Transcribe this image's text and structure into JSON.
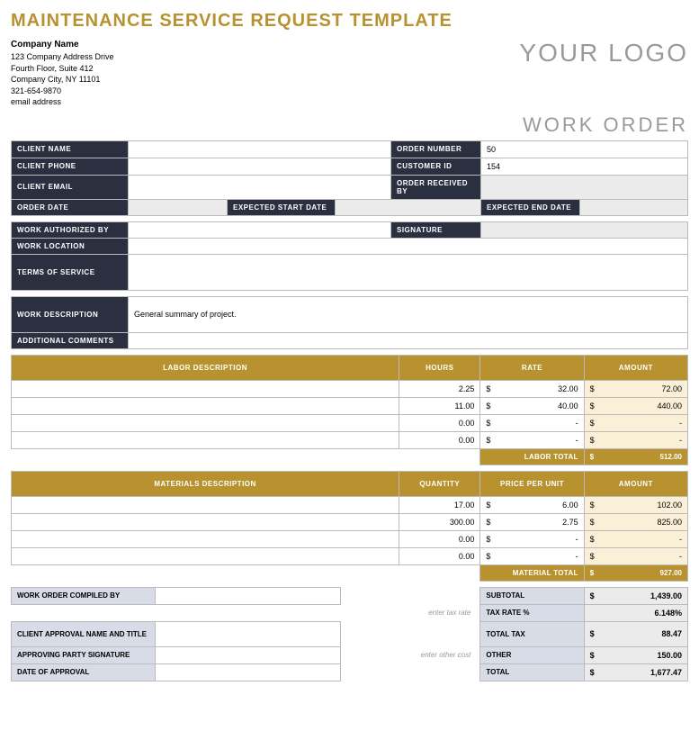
{
  "title": "MAINTENANCE SERVICE REQUEST TEMPLATE",
  "company": {
    "name": "Company Name",
    "address1": "123 Company Address Drive",
    "address2": "Fourth Floor, Suite 412",
    "city": "Company City, NY  11101",
    "phone": "321-654-9870",
    "email": "email address"
  },
  "logo": "YOUR LOGO",
  "work_order_label": "WORK ORDER",
  "labels": {
    "client_name": "CLIENT NAME",
    "client_phone": "CLIENT PHONE",
    "client_email": "CLIENT EMAIL",
    "order_number": "ORDER NUMBER",
    "customer_id": "CUSTOMER ID",
    "order_received_by": "ORDER RECEIVED BY",
    "order_date": "ORDER DATE",
    "expected_start": "EXPECTED START DATE",
    "expected_end": "EXPECTED END DATE",
    "work_authorized_by": "WORK AUTHORIZED BY",
    "signature": "SIGNATURE",
    "work_location": "WORK LOCATION",
    "terms_of_service": "TERMS OF SERVICE",
    "work_description": "WORK DESCRIPTION",
    "additional_comments": "ADDITIONAL COMMENTS",
    "labor_description": "LABOR DESCRIPTION",
    "hours": "HOURS",
    "rate": "RATE",
    "amount": "AMOUNT",
    "labor_total": "LABOR TOTAL",
    "materials_description": "MATERIALS DESCRIPTION",
    "quantity": "QUANTITY",
    "price_per_unit": "PRICE PER UNIT",
    "material_total": "MATERIAL TOTAL",
    "compiled_by": "WORK ORDER COMPILED BY",
    "client_approval": "CLIENT APPROVAL NAME AND TITLE",
    "approving_signature": "APPROVING PARTY SIGNATURE",
    "date_of_approval": "DATE OF APPROVAL",
    "subtotal": "SUBTOTAL",
    "tax_rate": "TAX RATE %",
    "total_tax": "TOTAL TAX",
    "other": "OTHER",
    "total": "TOTAL",
    "enter_tax_rate": "enter tax rate",
    "enter_other_cost": "enter other cost"
  },
  "values": {
    "order_number": "50",
    "customer_id": "154",
    "work_description": "General summary of project."
  },
  "labor": [
    {
      "hours": "2.25",
      "rate": "32.00",
      "amount": "72.00"
    },
    {
      "hours": "11.00",
      "rate": "40.00",
      "amount": "440.00"
    },
    {
      "hours": "0.00",
      "rate": "-",
      "amount": "-"
    },
    {
      "hours": "0.00",
      "rate": "-",
      "amount": "-"
    }
  ],
  "labor_total": "512.00",
  "materials": [
    {
      "qty": "17.00",
      "price": "6.00",
      "amount": "102.00"
    },
    {
      "qty": "300.00",
      "price": "2.75",
      "amount": "825.00"
    },
    {
      "qty": "0.00",
      "price": "-",
      "amount": "-"
    },
    {
      "qty": "0.00",
      "price": "-",
      "amount": "-"
    }
  ],
  "material_total": "927.00",
  "totals": {
    "subtotal": "1,439.00",
    "tax_rate": "6.148%",
    "total_tax": "88.47",
    "other": "150.00",
    "total": "1,677.47"
  }
}
